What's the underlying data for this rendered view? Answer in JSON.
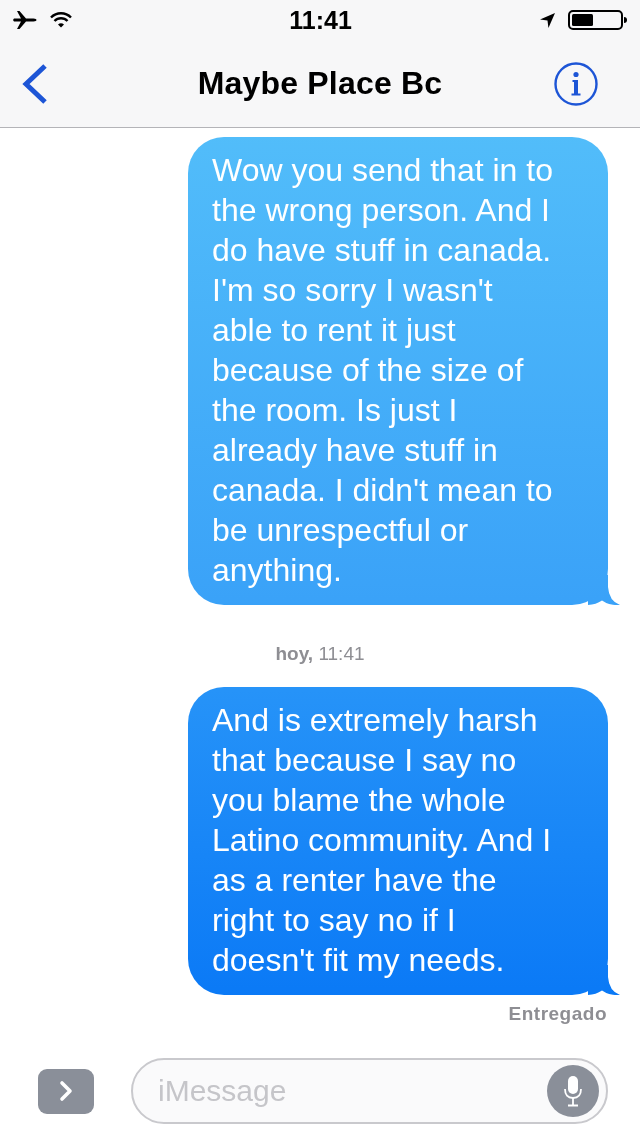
{
  "status_bar": {
    "time": "11:41"
  },
  "nav": {
    "title": "Maybe Place Bc"
  },
  "messages": [
    {
      "kind": "sent",
      "text": "Wow you send that in to the wrong person. And I do have stuff in canada. I'm so sorry I wasn't able to rent it just because of the size of the room. Is just I already have stuff in canada. I didn't mean to be unrespectful or anything."
    },
    {
      "kind": "timestamp",
      "text": "**hoy,** 11:41"
    },
    {
      "kind": "sent",
      "text": "And is extremely harsh that because I say no you blame the whole Latino community. And I as a renter have the right to say no if I doesn't fit my needs."
    }
  ],
  "delivery_status": "Entregado",
  "composer": {
    "placeholder": "iMessage"
  }
}
